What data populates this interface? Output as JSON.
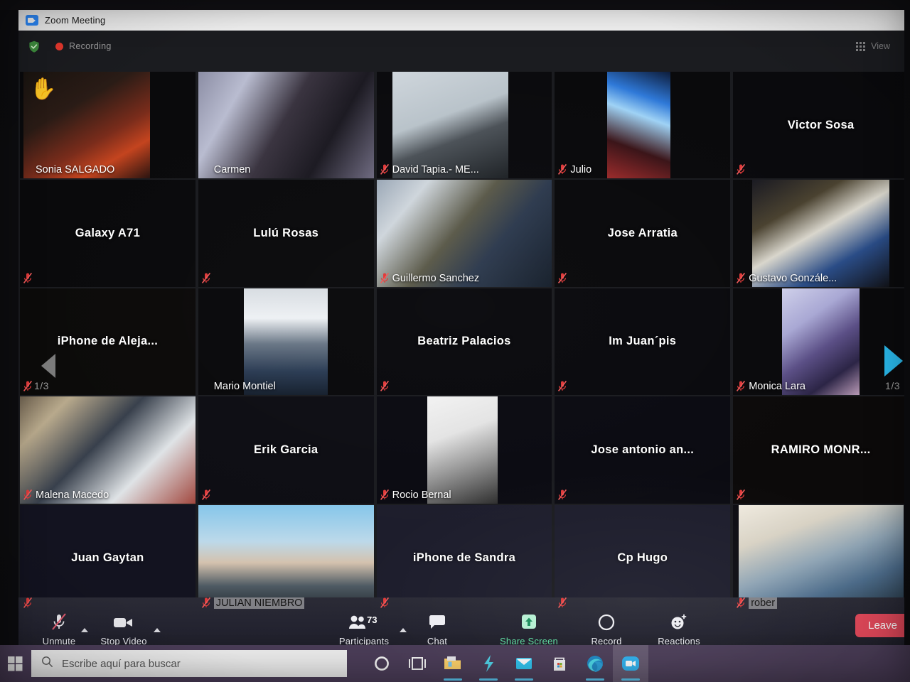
{
  "window": {
    "title": "Zoom Meeting",
    "app_icon": "zoom-icon"
  },
  "topbar": {
    "shield_icon": "encryption-shield-icon",
    "recording_label": "Recording",
    "recording_dot_color": "#e8392e",
    "view_label": "View",
    "view_icon": "grid-view-icon"
  },
  "gallery": {
    "page_indicator_left": "1/3",
    "page_indicator_right": "1/3",
    "prev_arrow_icon": "chevron-left-icon",
    "next_arrow_icon": "chevron-right-icon",
    "active_speaker_color": "#8fe04a",
    "tiles": [
      {
        "name": "Sonia SALGADO",
        "video": true,
        "muted": false,
        "hand_raised": true,
        "active": false,
        "name_pos": "bottom"
      },
      {
        "name": "Carmen",
        "video": true,
        "muted": false,
        "hand_raised": false,
        "active": true,
        "name_pos": "bottom"
      },
      {
        "name": "David Tapia.- ME...",
        "video": true,
        "muted": true,
        "hand_raised": false,
        "active": false,
        "name_pos": "bottom"
      },
      {
        "name": "Julio",
        "video": true,
        "muted": true,
        "hand_raised": false,
        "active": false,
        "name_pos": "bottom"
      },
      {
        "name": "Victor Sosa",
        "video": false,
        "muted": true,
        "hand_raised": false,
        "active": false,
        "name_pos": "center"
      },
      {
        "name": "Galaxy A71",
        "video": false,
        "muted": true,
        "hand_raised": false,
        "active": false,
        "name_pos": "center"
      },
      {
        "name": "Lulú Rosas",
        "video": false,
        "muted": true,
        "hand_raised": false,
        "active": false,
        "name_pos": "center"
      },
      {
        "name": "Guillermo Sanchez",
        "video": true,
        "muted": true,
        "hand_raised": false,
        "active": false,
        "name_pos": "bottom"
      },
      {
        "name": "Jose Arratia",
        "video": false,
        "muted": true,
        "hand_raised": false,
        "active": false,
        "name_pos": "center"
      },
      {
        "name": "Gustavo Gonzále...",
        "video": true,
        "muted": true,
        "hand_raised": false,
        "active": false,
        "name_pos": "bottom"
      },
      {
        "name": "iPhone de Aleja...",
        "video": false,
        "muted": true,
        "hand_raised": false,
        "active": false,
        "name_pos": "center"
      },
      {
        "name": "Mario Montiel",
        "video": true,
        "muted": false,
        "hand_raised": false,
        "active": false,
        "name_pos": "bottom"
      },
      {
        "name": "Beatriz Palacios",
        "video": false,
        "muted": true,
        "hand_raised": false,
        "active": false,
        "name_pos": "center"
      },
      {
        "name": "Im Juan´pis",
        "video": false,
        "muted": true,
        "hand_raised": false,
        "active": false,
        "name_pos": "center"
      },
      {
        "name": "Monica Lara",
        "video": true,
        "muted": true,
        "hand_raised": false,
        "active": false,
        "name_pos": "bottom"
      },
      {
        "name": "Malena Macedo",
        "video": true,
        "muted": true,
        "hand_raised": false,
        "active": false,
        "name_pos": "bottom"
      },
      {
        "name": "Erik Garcia",
        "video": false,
        "muted": true,
        "hand_raised": false,
        "active": false,
        "name_pos": "center"
      },
      {
        "name": "Rocio Bernal",
        "video": true,
        "muted": true,
        "hand_raised": false,
        "active": false,
        "name_pos": "bottom"
      },
      {
        "name": "Jose antonio an...",
        "video": false,
        "muted": true,
        "hand_raised": false,
        "active": false,
        "name_pos": "center"
      },
      {
        "name": "RAMIRO MONR...",
        "video": false,
        "muted": true,
        "hand_raised": false,
        "active": false,
        "name_pos": "center"
      },
      {
        "name": "Juan Gaytan",
        "video": false,
        "muted": true,
        "hand_raised": false,
        "active": false,
        "name_pos": "center"
      },
      {
        "name": "JULIAN NIEMBRO",
        "video": true,
        "muted": true,
        "hand_raised": false,
        "active": false,
        "name_pos": "bottom"
      },
      {
        "name": "iPhone de Sandra",
        "video": false,
        "muted": true,
        "hand_raised": false,
        "active": false,
        "name_pos": "center"
      },
      {
        "name": "Cp Hugo",
        "video": false,
        "muted": true,
        "hand_raised": false,
        "active": false,
        "name_pos": "center"
      },
      {
        "name": "rober",
        "video": true,
        "muted": true,
        "hand_raised": false,
        "active": false,
        "name_pos": "bottom"
      }
    ]
  },
  "toolbar": {
    "mute_label": "Unmute",
    "mute_icon": "microphone-muted-icon",
    "video_label": "Stop Video",
    "video_icon": "camera-icon",
    "participants_label": "Participants",
    "participants_icon": "people-icon",
    "participants_count": "73",
    "chat_label": "Chat",
    "chat_icon": "chat-bubble-icon",
    "share_label": "Share Screen",
    "share_icon": "share-screen-icon",
    "share_color": "#5ddba0",
    "record_label": "Record",
    "record_icon": "record-circle-icon",
    "reactions_label": "Reactions",
    "reactions_icon": "smiley-plus-icon",
    "leave_label": "Leave",
    "leave_color": "#e4485a"
  },
  "taskbar": {
    "start_icon": "windows-start-icon",
    "search_icon": "search-icon",
    "search_placeholder": "Escribe aquí para buscar",
    "apps": [
      {
        "name": "cortana-icon"
      },
      {
        "name": "task-view-icon"
      },
      {
        "name": "file-explorer-icon"
      },
      {
        "name": "lightning-app-icon"
      },
      {
        "name": "mail-icon"
      },
      {
        "name": "microsoft-store-icon"
      },
      {
        "name": "microsoft-edge-icon"
      },
      {
        "name": "zoom-taskbar-icon"
      }
    ]
  }
}
